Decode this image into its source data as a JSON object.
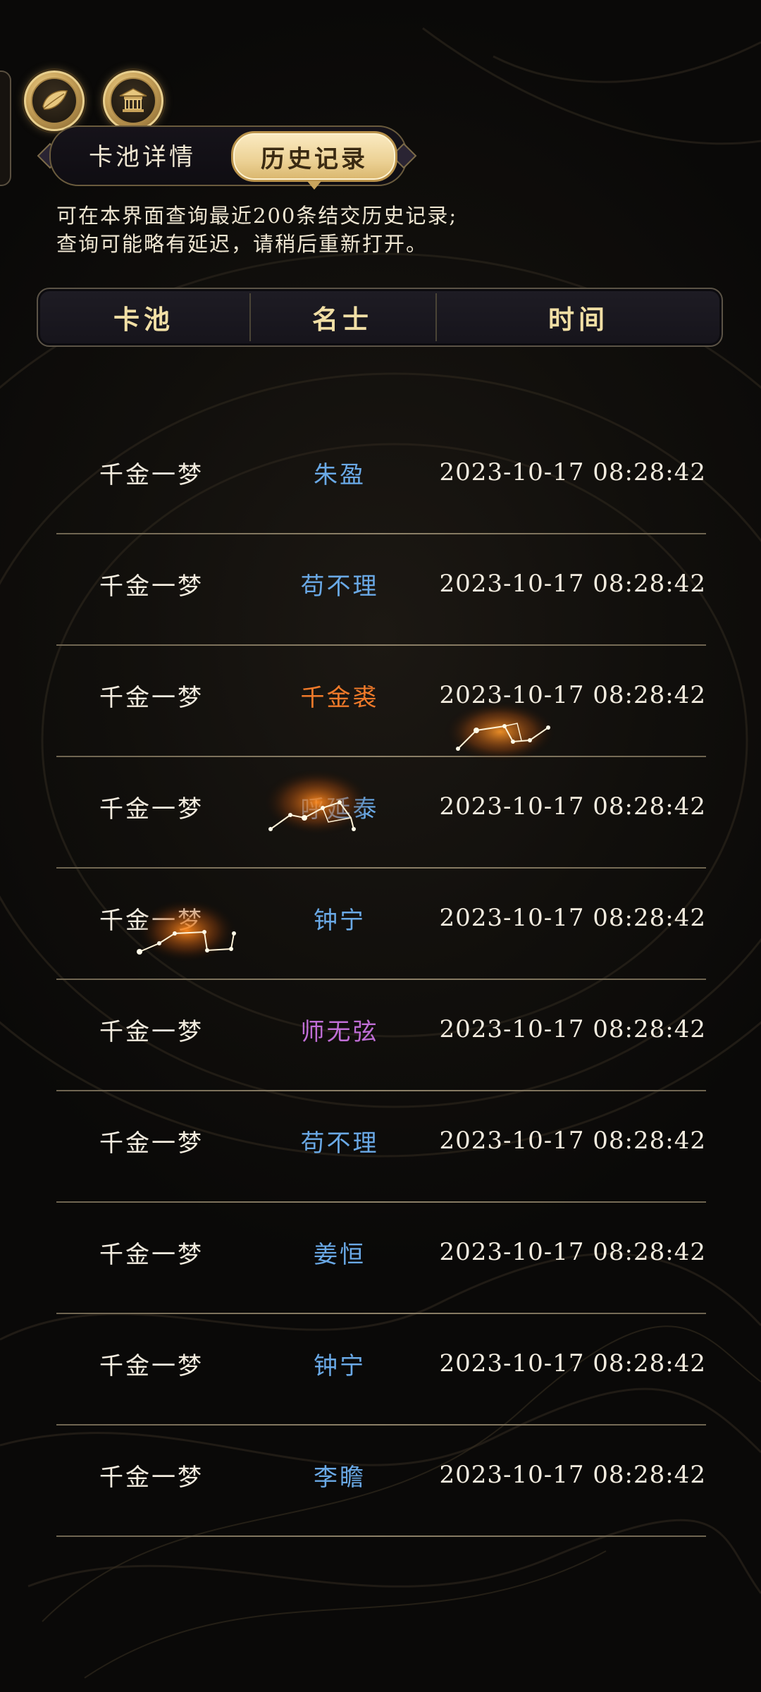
{
  "colors": {
    "name_blue": "#6aa9e6",
    "name_orange": "#f07a2a",
    "name_purple": "#c06ed6",
    "header_gold": "#f1dfa5",
    "tab_active_bg": "#ecd195"
  },
  "top_buttons": [
    {
      "icon": "leaf-icon"
    },
    {
      "icon": "pavilion-icon"
    }
  ],
  "tabs": {
    "pool_details": "卡池详情",
    "history": "历史记录",
    "active": "history"
  },
  "notice": {
    "line1": "可在本界面查询最近200条结交历史记录;",
    "line2": "查询可能略有延迟，请稍后重新打开。"
  },
  "table": {
    "headers": {
      "pool": "卡池",
      "name": "名士",
      "time": "时间"
    },
    "rows": [
      {
        "pool": "千金一梦",
        "name": "朱盈",
        "name_color": "#6aa9e6",
        "time": "2023-10-17 08:28:42"
      },
      {
        "pool": "千金一梦",
        "name": "苟不理",
        "name_color": "#6aa9e6",
        "time": "2023-10-17 08:28:42"
      },
      {
        "pool": "千金一梦",
        "name": "千金裘",
        "name_color": "#f07a2a",
        "time": "2023-10-17 08:28:42"
      },
      {
        "pool": "千金一梦",
        "name": "呼延泰",
        "name_color": "#6aa9e6",
        "time": "2023-10-17 08:28:42"
      },
      {
        "pool": "千金一梦",
        "name": "钟宁",
        "name_color": "#6aa9e6",
        "time": "2023-10-17 08:28:42"
      },
      {
        "pool": "千金一梦",
        "name": "师无弦",
        "name_color": "#c06ed6",
        "time": "2023-10-17 08:28:42"
      },
      {
        "pool": "千金一梦",
        "name": "苟不理",
        "name_color": "#6aa9e6",
        "time": "2023-10-17 08:28:42"
      },
      {
        "pool": "千金一梦",
        "name": "姜恒",
        "name_color": "#6aa9e6",
        "time": "2023-10-17 08:28:42"
      },
      {
        "pool": "千金一梦",
        "name": "钟宁",
        "name_color": "#6aa9e6",
        "time": "2023-10-17 08:28:42"
      },
      {
        "pool": "千金一梦",
        "name": "李瞻",
        "name_color": "#6aa9e6",
        "time": "2023-10-17 08:28:42"
      }
    ]
  }
}
